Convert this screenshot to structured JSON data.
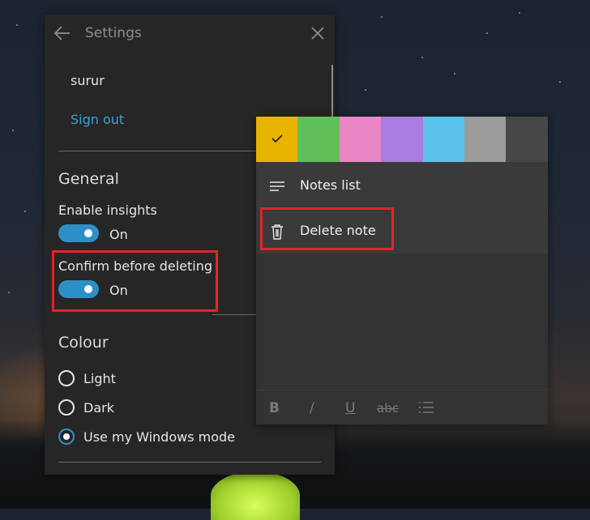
{
  "settings": {
    "title": "Settings",
    "user_name": "surur",
    "sign_out": "Sign out",
    "general": {
      "heading": "General",
      "insights_label": "Enable insights",
      "insights_state": "On",
      "confirm_label": "Confirm before deleting",
      "confirm_state": "On"
    },
    "colour": {
      "heading": "Colour",
      "options": [
        "Light",
        "Dark",
        "Use my Windows mode"
      ],
      "selected": "Use my Windows mode"
    }
  },
  "note_menu": {
    "swatches": [
      "#e8b400",
      "#62c05b",
      "#e886c6",
      "#a97ee0",
      "#5bc3ea",
      "#9c9c9c",
      "#464646"
    ],
    "selected_swatch": "#e8b400",
    "items": [
      {
        "label": "Notes list",
        "icon": "list-icon"
      },
      {
        "label": "Delete note",
        "icon": "trash-icon"
      }
    ],
    "format_bar": {
      "bold": "B",
      "italic": "/",
      "underline": "U",
      "strikethrough": "abc",
      "list_icon": "bullet-list-icon"
    }
  },
  "colors": {
    "accent": "#2d8fc8",
    "link": "#3ba0dd",
    "highlight_border": "#e0242b"
  }
}
